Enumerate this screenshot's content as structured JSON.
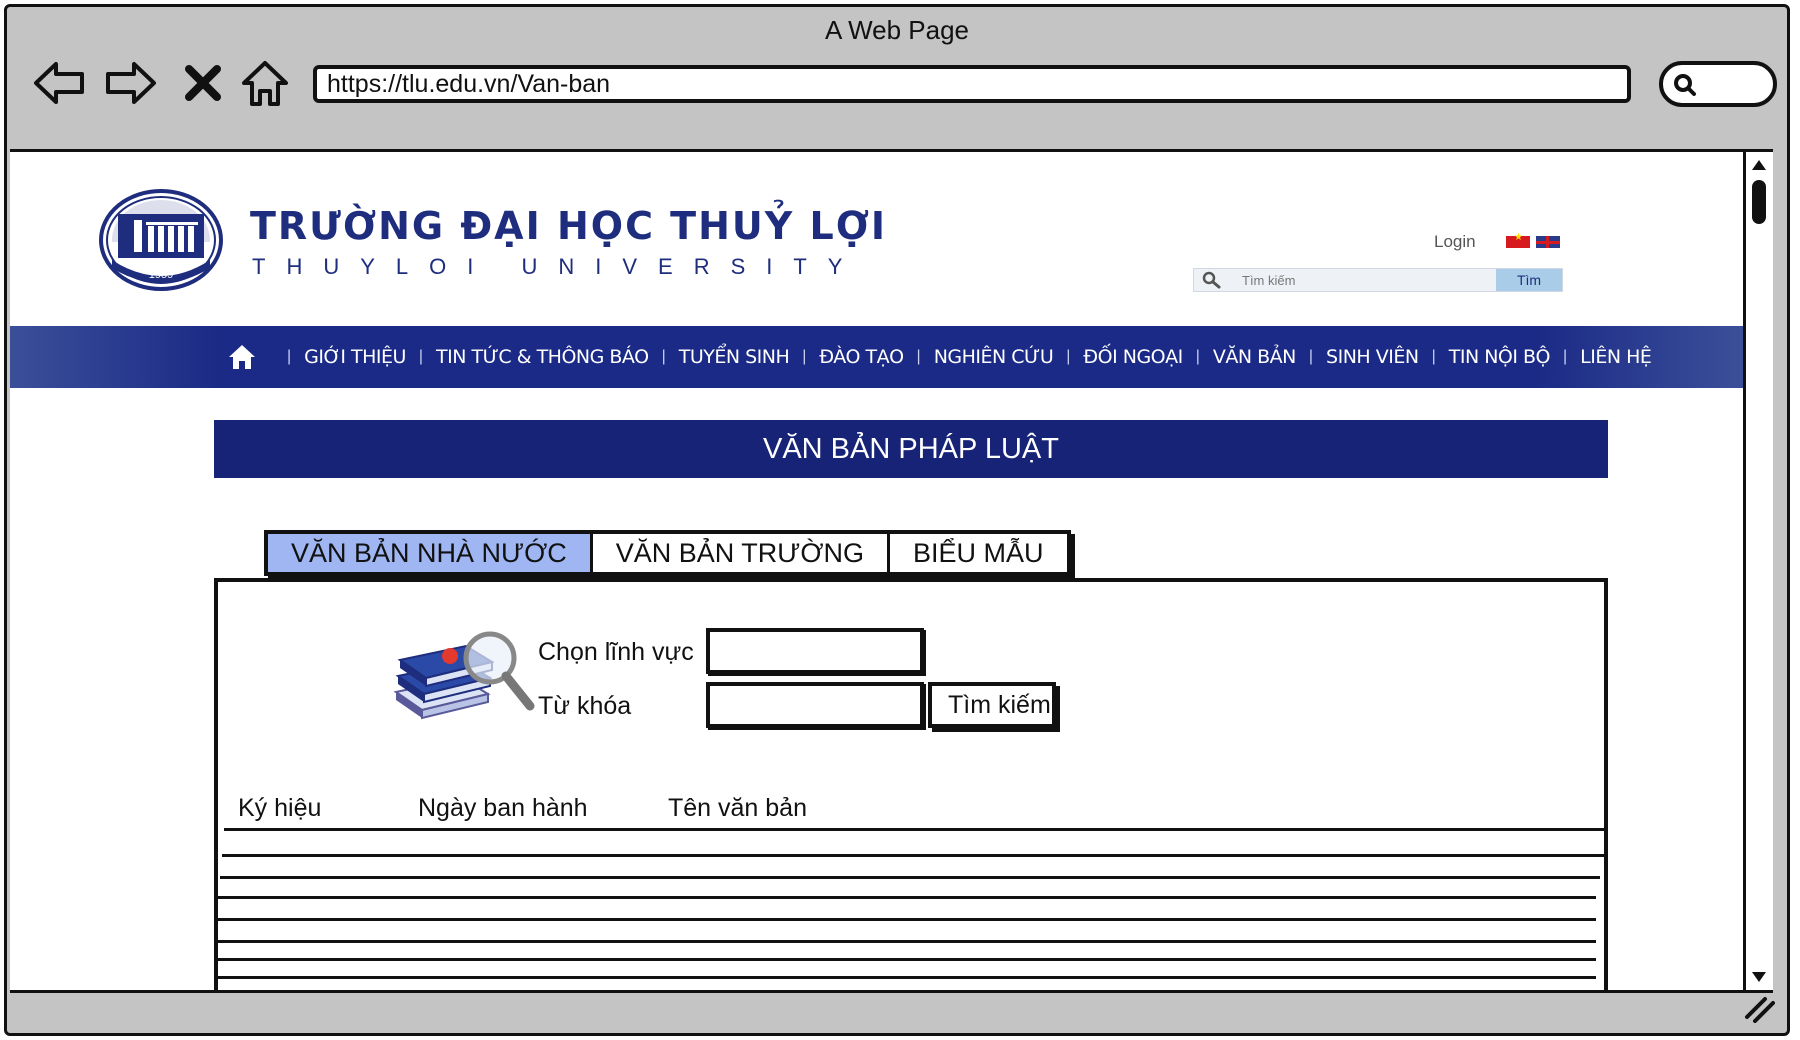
{
  "browser": {
    "title": "A Web Page",
    "url": "https://tlu.edu.vn/Van-ban"
  },
  "header": {
    "logo_text": "ĐHTL 1959",
    "name": "TRƯỜNG ĐẠI HỌC THUỶ LỢI",
    "subtitle": "THUYLOI UNIVERSITY",
    "login": "Login",
    "search_placeholder": "Tìm kiếm",
    "search_button": "Tìm"
  },
  "nav": {
    "items": [
      "GIỚI THIỆU",
      "TIN TỨC & THÔNG BÁO",
      "TUYỂN SINH",
      "ĐÀO TẠO",
      "NGHIÊN CỨU",
      "ĐỐI NGOẠI",
      "VĂN BẢN",
      "SINH VIÊN",
      "TIN NỘI BỘ",
      "LIÊN HỆ"
    ]
  },
  "section_title": "VĂN BẢN PHÁP LUẬT",
  "tabs": [
    {
      "label": "VĂN BẢN NHÀ NƯỚC",
      "active": true
    },
    {
      "label": "VĂN BẢN TRƯỜNG",
      "active": false
    },
    {
      "label": "BIỂU MẪU",
      "active": false
    }
  ],
  "form": {
    "field_label": "Chọn lĩnh vực",
    "field_value": "",
    "keyword_label": "Từ khóa",
    "keyword_value": "",
    "search_button": "Tìm kiếm"
  },
  "table": {
    "columns": [
      "Ký hiệu",
      "Ngày ban hành",
      "Tên văn bản"
    ],
    "rows": []
  },
  "colors": {
    "brand_blue": "#172376",
    "active_tab": "#9fb6f3",
    "chrome_gray": "#c4c4c4"
  }
}
